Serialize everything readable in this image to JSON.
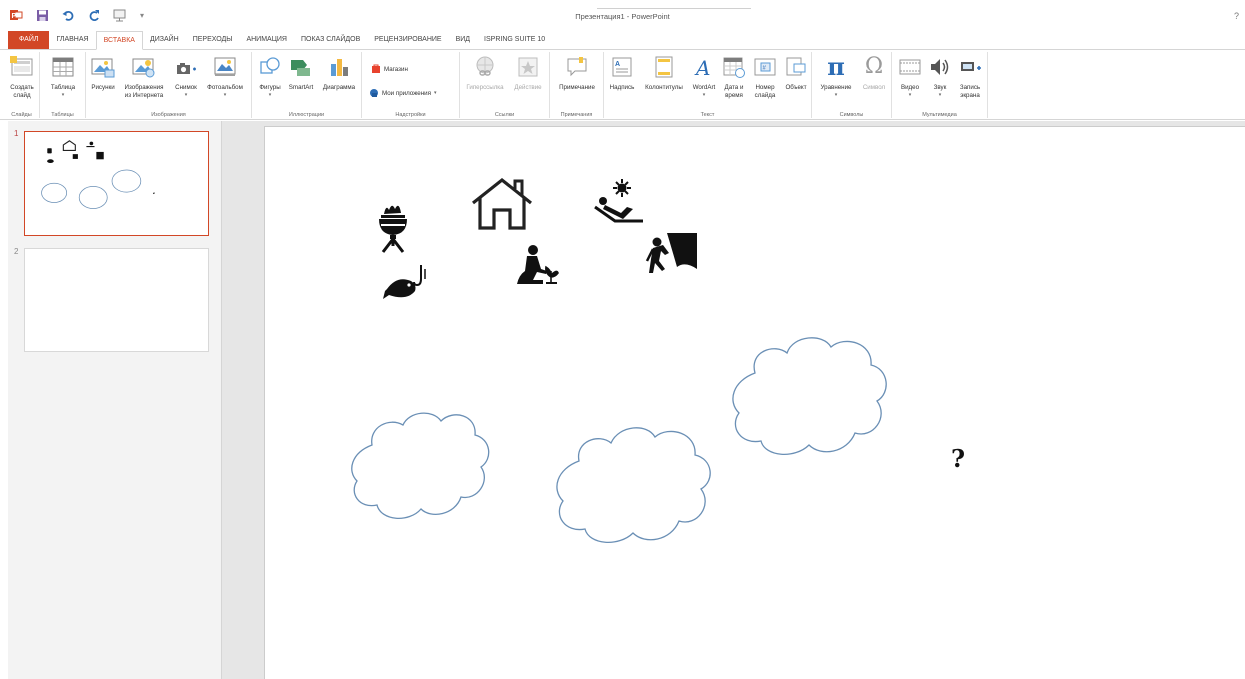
{
  "app": {
    "title": "Презентация1 - PowerPoint",
    "help": "?"
  },
  "tabs": [
    {
      "label": "ФАЙЛ"
    },
    {
      "label": "ГЛАВНАЯ"
    },
    {
      "label": "ВСТАВКА"
    },
    {
      "label": "ДИЗАЙН"
    },
    {
      "label": "ПЕРЕХОДЫ"
    },
    {
      "label": "АНИМАЦИЯ"
    },
    {
      "label": "ПОКАЗ СЛАЙДОВ"
    },
    {
      "label": "РЕЦЕНЗИРОВАНИЕ"
    },
    {
      "label": "ВИД"
    },
    {
      "label": "ISPRING SUITE 10"
    }
  ],
  "ribbon": {
    "groups": {
      "slides": "Слайды",
      "tables": "Таблицы",
      "images": "Изображения",
      "illustrations": "Иллюстрации",
      "addins": "Надстройки",
      "links": "Ссылки",
      "comments": "Примечания",
      "text": "Текст",
      "symbols": "Символы",
      "media": "Мультимедиа"
    },
    "buttons": {
      "new_slide_1": "Создать",
      "new_slide_2": "слайд",
      "table": "Таблица",
      "pictures": "Рисунки",
      "online_1": "Изображения",
      "online_2": "из Интернета",
      "screenshot": "Снимок",
      "photo_album": "Фотоальбом",
      "shapes": "Фигуры",
      "smartart": "SmartArt",
      "chart": "Диаграмма",
      "store": "Магазин",
      "my_apps": "Мои приложения",
      "hyperlink": "Гиперссылка",
      "action": "Действие",
      "comment": "Примечание",
      "textbox": "Надпись",
      "header_footer": "Колонтитулы",
      "wordart": "WordArt",
      "datetime_1": "Дата и",
      "datetime_2": "время",
      "slide_num_1": "Номер",
      "slide_num_2": "слайда",
      "object": "Объект",
      "equation": "Уравнение",
      "symbol": "Символ",
      "video": "Видео",
      "audio": "Звук",
      "screenrec_1": "Запись",
      "screenrec_2": "экрана"
    }
  },
  "thumbnails": [
    {
      "number": "1"
    },
    {
      "number": "2"
    }
  ],
  "slide": {
    "question_mark": "?"
  },
  "colors": {
    "accent": "#d24726",
    "cloud_stroke": "#6a8fb5"
  },
  "icons": [
    "grill-icon",
    "house-icon",
    "sunbathing-icon",
    "gardener-icon",
    "climber-icon",
    "fishing-icon",
    "question-icon",
    "cloud-shape"
  ]
}
